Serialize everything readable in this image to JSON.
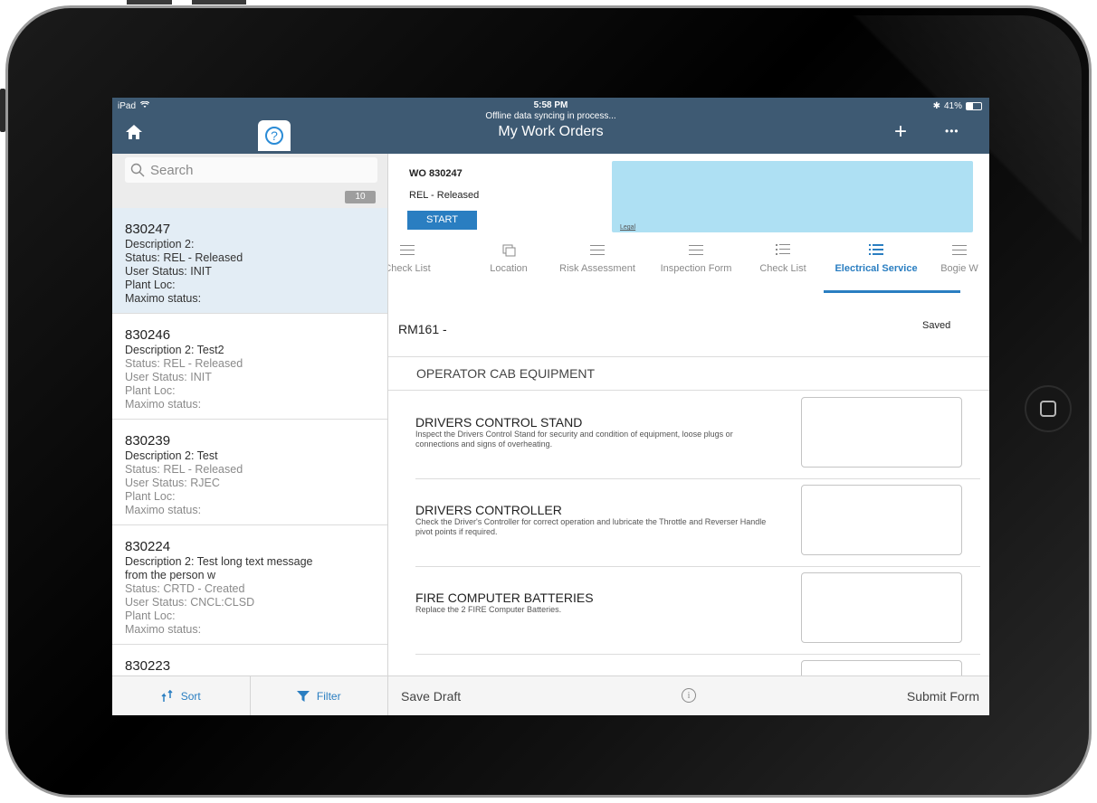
{
  "status_bar": {
    "device": "iPad",
    "time": "5:58 PM",
    "sync_message": "Offline data syncing in process...",
    "battery_text": "41%",
    "battery_level": 0.41
  },
  "header": {
    "title": "My Work Orders",
    "help_label": "?",
    "add_label": "+",
    "more_label": "•••"
  },
  "sidebar": {
    "search_placeholder": "Search",
    "count": "10",
    "items": [
      {
        "number": "830247",
        "lines": [
          "Description 2:",
          "Status: REL - Released",
          "User Status: INIT",
          "Plant Loc:",
          "Maximo status:"
        ]
      },
      {
        "number": "830246",
        "lines": [
          "Description 2: Test2",
          "Status: REL - Released",
          "User Status: INIT",
          "Plant Loc:",
          "Maximo status:"
        ]
      },
      {
        "number": "830239",
        "lines": [
          "Description 2: Test",
          "Status: REL - Released",
          "User Status: RJEC",
          "Plant Loc:",
          "Maximo status:"
        ]
      },
      {
        "number": "830224",
        "lines": [
          "Description 2: Test long text message",
          "from the person w",
          "Status: CRTD - Created",
          "User Status: CNCL:CLSD",
          "Plant Loc:",
          "Maximo status:"
        ]
      },
      {
        "number": "830223",
        "lines": []
      }
    ],
    "sort_label": "Sort",
    "filter_label": "Filter"
  },
  "detail": {
    "wo_title": "WO 830247",
    "wo_status": "REL - Released",
    "start_label": "START",
    "legal_label": "Legal",
    "tabs": [
      {
        "label": "Check List",
        "icon": "list-icon"
      },
      {
        "label": "Location",
        "icon": "map-icon"
      },
      {
        "label": "Risk Assessment",
        "icon": "list-icon"
      },
      {
        "label": "Inspection Form",
        "icon": "list-icon"
      },
      {
        "label": "Check List",
        "icon": "checklist-icon"
      },
      {
        "label": "Electrical Service",
        "icon": "checklist-icon",
        "active": true
      },
      {
        "label": "Bogie W",
        "icon": "list-icon"
      }
    ],
    "form_id": "RM161 -",
    "saved_label": "Saved",
    "section_title": "OPERATOR CAB EQUIPMENT",
    "check_items": [
      {
        "title": "DRIVERS CONTROL STAND",
        "description": "Inspect the Drivers Control Stand for security and condition of equipment, loose plugs or connections and signs of overheating."
      },
      {
        "title": "DRIVERS CONTROLLER",
        "description": "Check the Driver's Controller for correct operation and lubricate the Throttle and Reverser Handle pivot points if required."
      },
      {
        "title": "FIRE COMPUTER BATTERIES",
        "description": "Replace the 2 FIRE Computer Batteries."
      }
    ],
    "save_draft_label": "Save Draft",
    "info_label": "i",
    "submit_label": "Submit Form"
  },
  "colors": {
    "header_bg": "#3e5a73",
    "accent": "#2a7ec1",
    "selected_row": "#e3edf5",
    "legal_box": "#aee0f3"
  }
}
